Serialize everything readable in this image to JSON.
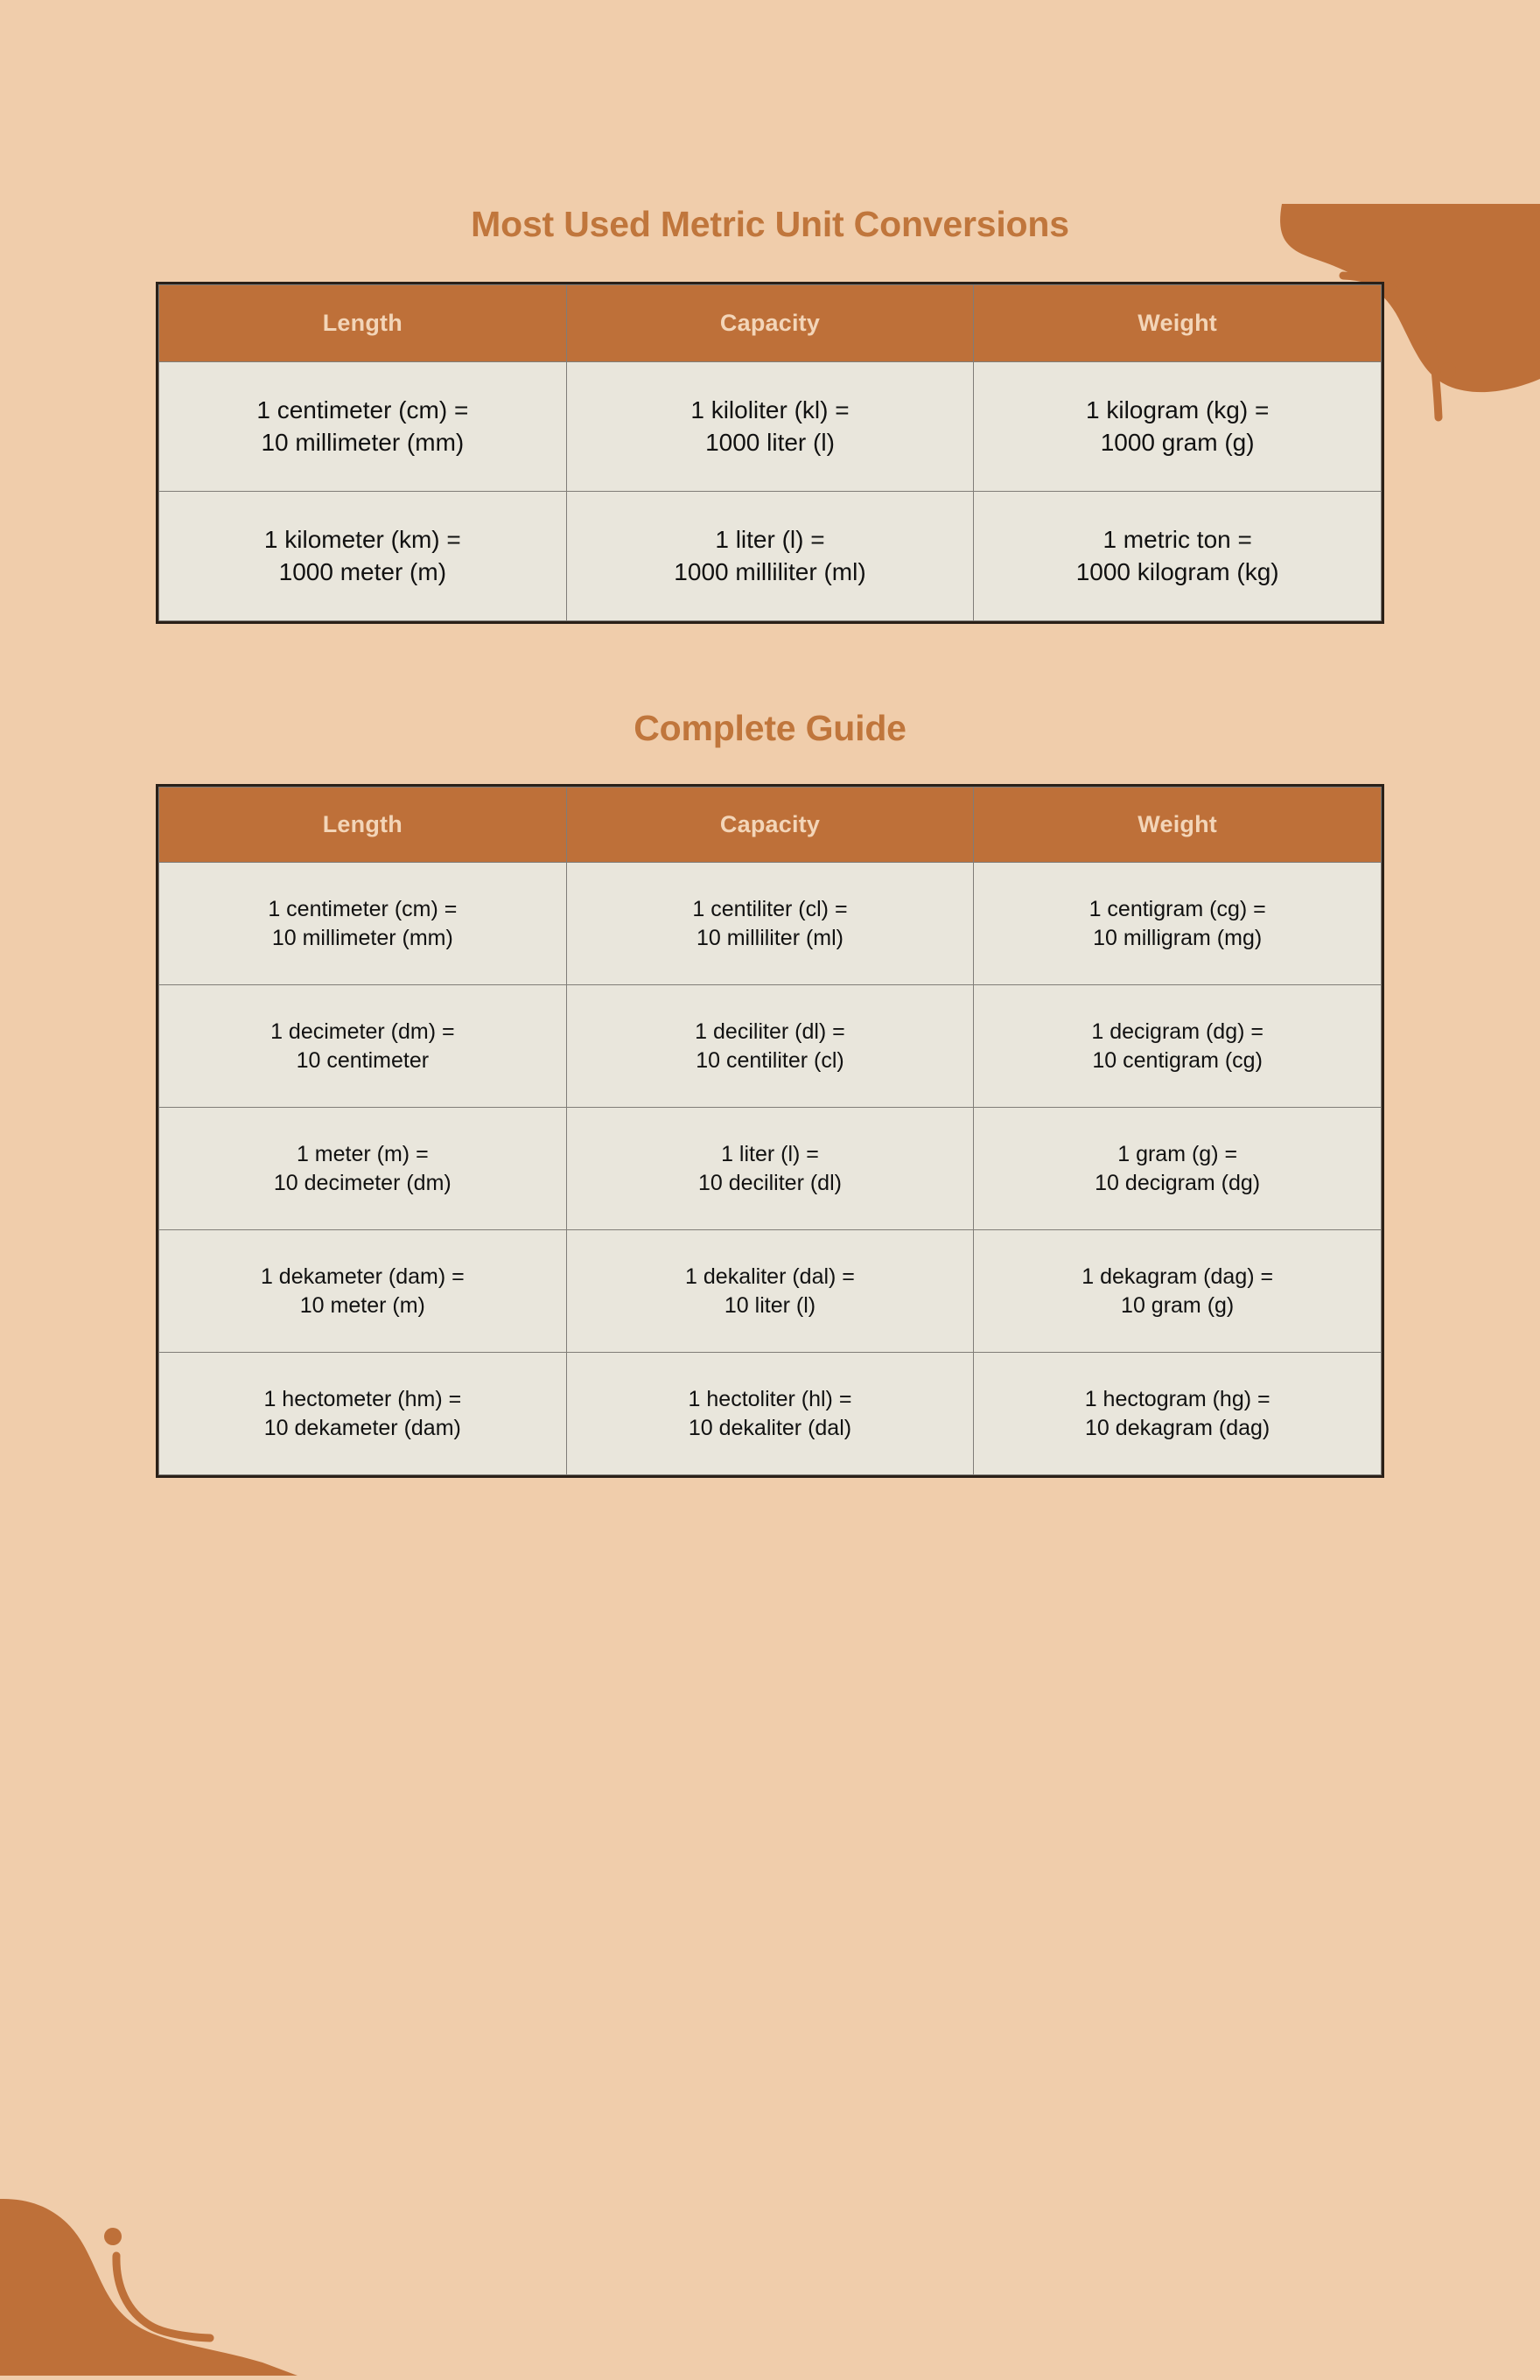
{
  "theme": {
    "background": "#F0CDAB",
    "accent": "#BE7039",
    "title_color": "#C0763C",
    "header_text": "#F3D5B8",
    "cell_background": "#E9E6DC",
    "cell_text": "#111111",
    "table_border": "#2A2018",
    "grid_line": "#807D78"
  },
  "decor": {
    "top_right": "blob-with-arc-and-dot",
    "bottom_left": "blob-with-arc-and-dot"
  },
  "sections": [
    {
      "title": "Most Used Metric Unit Conversions",
      "headers": [
        "Length",
        "Capacity",
        "Weight"
      ],
      "rows": [
        [
          {
            "line1": "1 centimeter (cm) =",
            "line2": "10 millimeter (mm)"
          },
          {
            "line1": "1 kiloliter (kl) =",
            "line2": "1000 liter (l)"
          },
          {
            "line1": "1 kilogram (kg) =",
            "line2": "1000 gram (g)"
          }
        ],
        [
          {
            "line1": "1 kilometer (km) =",
            "line2": "1000 meter (m)"
          },
          {
            "line1": "1 liter (l) =",
            "line2": "1000 milliliter (ml)"
          },
          {
            "line1": "1 metric ton =",
            "line2": "1000 kilogram (kg)"
          }
        ]
      ]
    },
    {
      "title": "Complete Guide",
      "headers": [
        "Length",
        "Capacity",
        "Weight"
      ],
      "rows": [
        [
          {
            "line1": "1 centimeter (cm) =",
            "line2": "10 millimeter (mm)"
          },
          {
            "line1": "1 centiliter (cl) =",
            "line2": "10 milliliter (ml)"
          },
          {
            "line1": "1 centigram (cg) =",
            "line2": "10 milligram (mg)"
          }
        ],
        [
          {
            "line1": "1 decimeter (dm) =",
            "line2": "10 centimeter"
          },
          {
            "line1": "1 deciliter (dl) =",
            "line2": "10 centiliter (cl)"
          },
          {
            "line1": "1 decigram (dg) =",
            "line2": "10 centigram (cg)"
          }
        ],
        [
          {
            "line1": "1 meter (m) =",
            "line2": "10 decimeter (dm)"
          },
          {
            "line1": "1 liter (l) =",
            "line2": "10 deciliter (dl)"
          },
          {
            "line1": "1 gram (g) =",
            "line2": "10 decigram (dg)"
          }
        ],
        [
          {
            "line1": "1 dekameter (dam) =",
            "line2": "10 meter (m)"
          },
          {
            "line1": "1 dekaliter (dal) =",
            "line2": "10 liter (l)"
          },
          {
            "line1": "1 dekagram (dag) =",
            "line2": "10 gram (g)"
          }
        ],
        [
          {
            "line1": "1 hectometer (hm) =",
            "line2": "10 dekameter (dam)"
          },
          {
            "line1": "1 hectoliter (hl) =",
            "line2": "10 dekaliter (dal)"
          },
          {
            "line1": "1 hectogram (hg) =",
            "line2": "10 dekagram (dag)"
          }
        ]
      ]
    }
  ]
}
